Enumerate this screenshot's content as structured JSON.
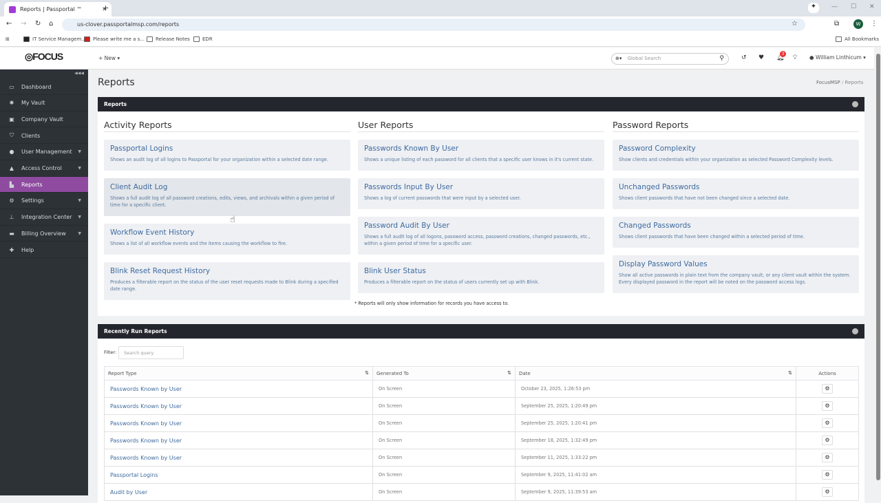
{
  "browser": {
    "tab_title": "Reports | Passportal ™",
    "url": "us-clover.passportalmsp.com/reports",
    "bookmarks": [
      "IT Service Managem...",
      "Please write me a s...",
      "Release Notes",
      "EDR"
    ],
    "all_bookmarks": "All Bookmarks",
    "profile": "W"
  },
  "header": {
    "logo": "FOCUS MSP",
    "new_label": "New",
    "search_placeholder": "Global Search",
    "notification_count": "3",
    "user": "William Linthicum"
  },
  "sidebar": {
    "items": [
      {
        "label": "Dashboard",
        "icon": "▭"
      },
      {
        "label": "My Vault",
        "icon": "✱"
      },
      {
        "label": "Company Vault",
        "icon": "▣"
      },
      {
        "label": "Clients",
        "icon": "⛉"
      },
      {
        "label": "User Management",
        "icon": "●",
        "caret": true
      },
      {
        "label": "Access Control",
        "icon": "▲",
        "caret": true
      },
      {
        "label": "Reports",
        "icon": "▙",
        "active": true
      },
      {
        "label": "Settings",
        "icon": "⚙",
        "caret": true
      },
      {
        "label": "Integration Center",
        "icon": "⊥",
        "caret": true
      },
      {
        "label": "Billing Overview",
        "icon": "▬",
        "caret": true
      },
      {
        "label": "Help",
        "icon": "✚"
      }
    ]
  },
  "page": {
    "title": "Reports",
    "breadcrumb": [
      "FocusMSP",
      "Reports"
    ]
  },
  "reports_panel": {
    "title": "Reports",
    "note": "* Reports will only show information for records you have access to.",
    "columns": [
      {
        "heading": "Activity Reports",
        "cards": [
          {
            "title": "Passportal Logins",
            "desc": "Shows an audit log of all logins to Passportal for your organization within a selected date range."
          },
          {
            "title": "Client Audit Log",
            "desc": "Shows a full audit log of all password creations, edits, views, and archivals within a given period of time for a specific client."
          },
          {
            "title": "Workflow Event History",
            "desc": "Shows a list of all workflow events and the items causing the workflow to fire."
          },
          {
            "title": "Blink Reset Request History",
            "desc": "Produces a filterable report on the status of the user reset requests made to Blink during a specified date range."
          }
        ]
      },
      {
        "heading": "User Reports",
        "cards": [
          {
            "title": "Passwords Known By User",
            "desc": "Shows a unique listing of each password for all clients that a specific user knows in it's current state."
          },
          {
            "title": "Passwords Input By User",
            "desc": "Shows a log of current passwords that were input by a selected user."
          },
          {
            "title": "Password Audit By User",
            "desc": "Shows a full audit log of all logons, password access, password creations, changed passwords, etc., within a given period of time for a specific user."
          },
          {
            "title": "Blink User Status",
            "desc": "Produces a filterable report on the status of users currently set up with Blink."
          }
        ]
      },
      {
        "heading": "Password Reports",
        "cards": [
          {
            "title": "Password Complexity",
            "desc": "Show clients and credentials within your organization as selected Password Complexity levels."
          },
          {
            "title": "Unchanged Passwords",
            "desc": "Shows client passwords that have not been changed since a selected date."
          },
          {
            "title": "Changed Passwords",
            "desc": "Shows client passwords that have been changed within a selected period of time."
          },
          {
            "title": "Display Password Values",
            "desc": "Show all active passwords in plain text from the company vault, or any client vault within the system. Every displayed password in the report will be noted on the password access logs."
          }
        ]
      }
    ]
  },
  "recent_panel": {
    "title": "Recently Run Reports",
    "filter_label": "Filter:",
    "filter_placeholder": "Search query",
    "headers": [
      "Report Type",
      "Generated To",
      "Date",
      "Actions"
    ],
    "rows": [
      [
        "Passwords Known by User",
        "On Screen",
        "October 23, 2025, 1:26:53 pm"
      ],
      [
        "Passwords Known by User",
        "On Screen",
        "September 25, 2025, 1:20:49 pm"
      ],
      [
        "Passwords Known by User",
        "On Screen",
        "September 25, 2025, 1:20:41 pm"
      ],
      [
        "Passwords Known by User",
        "On Screen",
        "September 18, 2025, 1:32:49 pm"
      ],
      [
        "Passwords Known by User",
        "On Screen",
        "September 11, 2025, 1:33:22 pm"
      ],
      [
        "Passportal Logins",
        "On Screen",
        "September 9, 2025, 11:41:02 am"
      ],
      [
        "Audit by User",
        "On Screen",
        "September 9, 2025, 11:39:53 am"
      ]
    ]
  }
}
